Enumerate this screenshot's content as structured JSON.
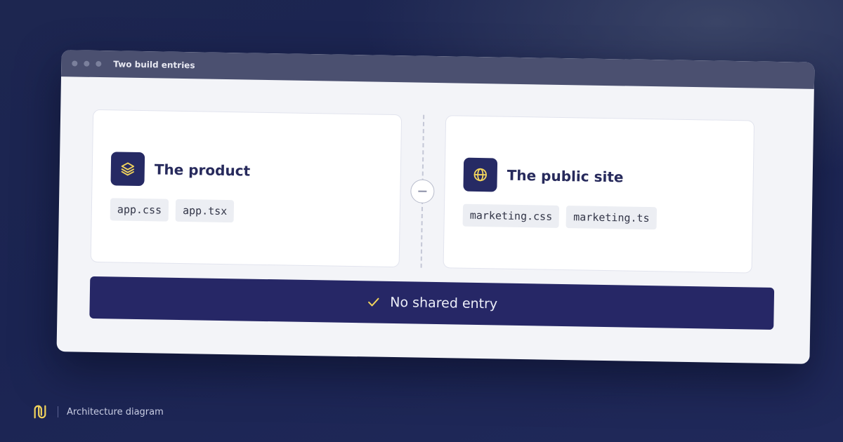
{
  "window": {
    "title": "Two build entries"
  },
  "cards": [
    {
      "title": "The product",
      "icon": "layers-icon",
      "files": [
        "app.css",
        "app.tsx"
      ]
    },
    {
      "title": "The public site",
      "icon": "globe-icon",
      "files": [
        "marketing.css",
        "marketing.ts"
      ]
    }
  ],
  "divider": {
    "icon": "minus-icon"
  },
  "banner": {
    "icon": "check-icon",
    "text": "No shared entry"
  },
  "footer": {
    "logo": "brand-logo-icon",
    "text": "Architecture diagram"
  },
  "colors": {
    "background": "#1d2650",
    "accent": "#f2d45c",
    "card_icon_bg": "#262a64",
    "banner_bg": "#262766",
    "title_text": "#272a5c"
  }
}
